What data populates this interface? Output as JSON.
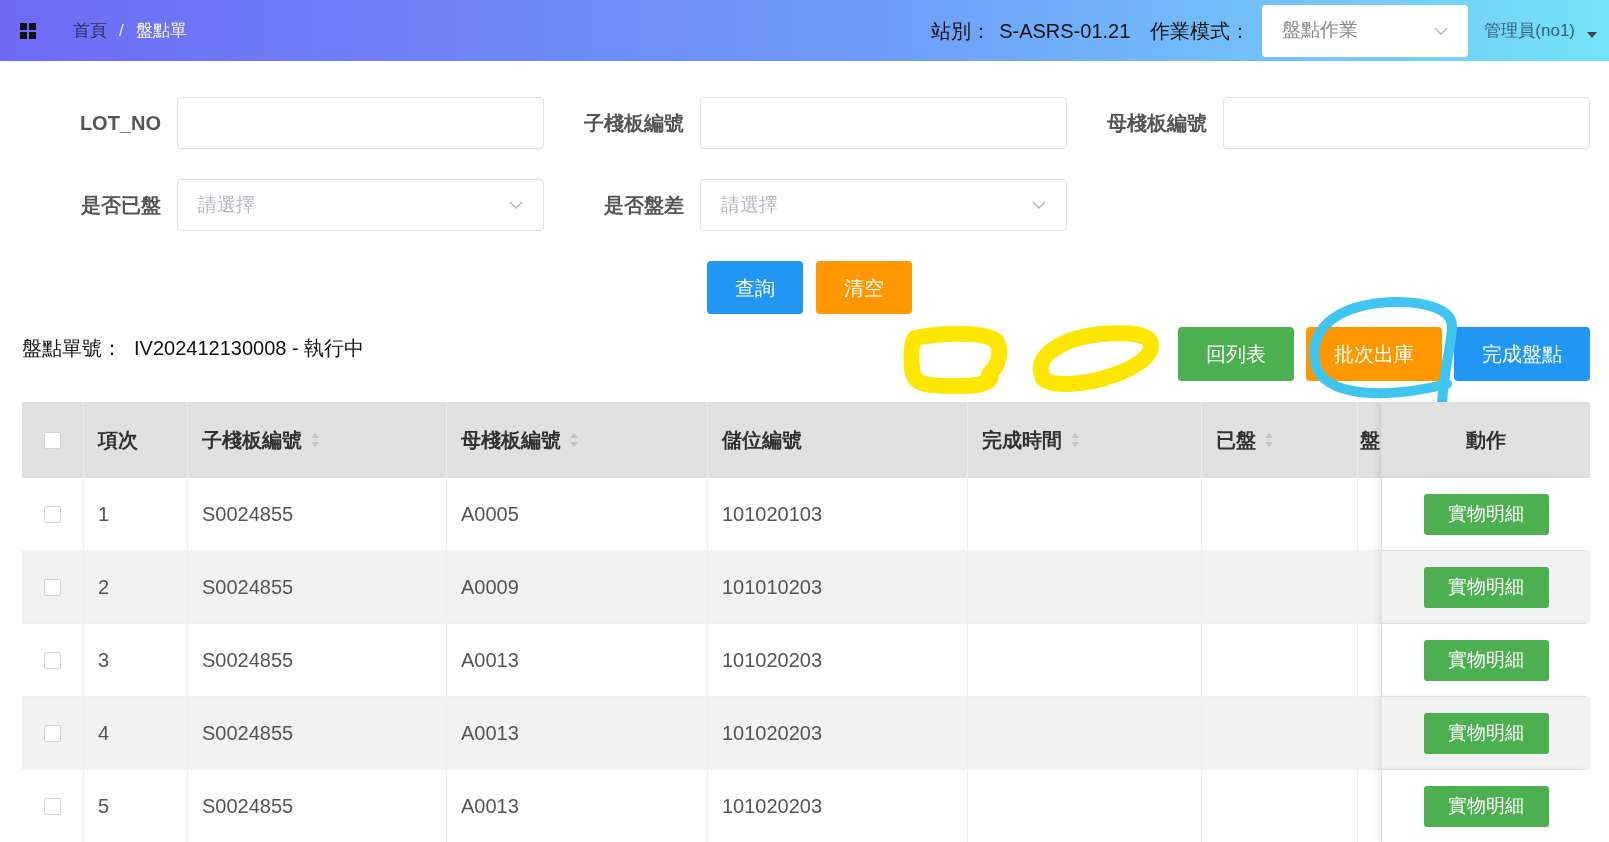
{
  "header": {
    "breadcrumb": [
      "首頁",
      "盤點單"
    ],
    "separator": "/",
    "station_label": "站別：",
    "station": "S-ASRS-01.21",
    "mode_label": "作業模式：",
    "mode": "盤點作業",
    "user": "管理員(no1)"
  },
  "filters": [
    {
      "label": "LOT_NO",
      "kind": "text"
    },
    {
      "label": "子棧板編號",
      "kind": "text"
    },
    {
      "label": "母棧板編號",
      "kind": "text"
    },
    {
      "label": "是否已盤",
      "kind": "select",
      "placeholder": "請選擇"
    },
    {
      "label": "是否盤差",
      "kind": "select",
      "placeholder": "請選擇"
    }
  ],
  "filter_buttons": [
    {
      "label": "查詢",
      "kind": "primary"
    },
    {
      "label": "清空",
      "kind": "warning"
    }
  ],
  "order": {
    "label": "盤點單號：",
    "value": "IV202412130008 - 執行中"
  },
  "actions": [
    {
      "label": "回列表",
      "kind": "success"
    },
    {
      "label": "批次出庫",
      "kind": "warning"
    },
    {
      "label": "完成盤點",
      "kind": "primary"
    }
  ],
  "table": {
    "select_all": {
      "checked": false
    },
    "columns": [
      {
        "label": "項次",
        "sortable": false
      },
      {
        "label": "子棧板編號",
        "sortable": true
      },
      {
        "label": "母棧板編號",
        "sortable": true
      },
      {
        "label": "儲位編號",
        "sortable": false
      },
      {
        "label": "完成時間",
        "sortable": true
      },
      {
        "label": "已盤",
        "sortable": true
      },
      {
        "label": "盤"
      },
      {
        "label": "動作",
        "sortable": false
      }
    ],
    "rows": [
      {
        "checked": false,
        "cells": [
          "1",
          "S0024855",
          "A0005",
          "101020103",
          "",
          "",
          ""
        ],
        "action": "實物明細"
      },
      {
        "checked": false,
        "cells": [
          "2",
          "S0024855",
          "A0009",
          "101010203",
          "",
          "",
          ""
        ],
        "action": "實物明細"
      },
      {
        "checked": false,
        "cells": [
          "3",
          "S0024855",
          "A0013",
          "101020203",
          "",
          "",
          ""
        ],
        "action": "實物明細"
      },
      {
        "checked": false,
        "cells": [
          "4",
          "S0024855",
          "A0013",
          "101020203",
          "",
          "",
          ""
        ],
        "action": "實物明細"
      },
      {
        "checked": false,
        "cells": [
          "5",
          "S0024855",
          "A0013",
          "101020203",
          "",
          "",
          ""
        ],
        "action": "實物明細"
      }
    ]
  }
}
